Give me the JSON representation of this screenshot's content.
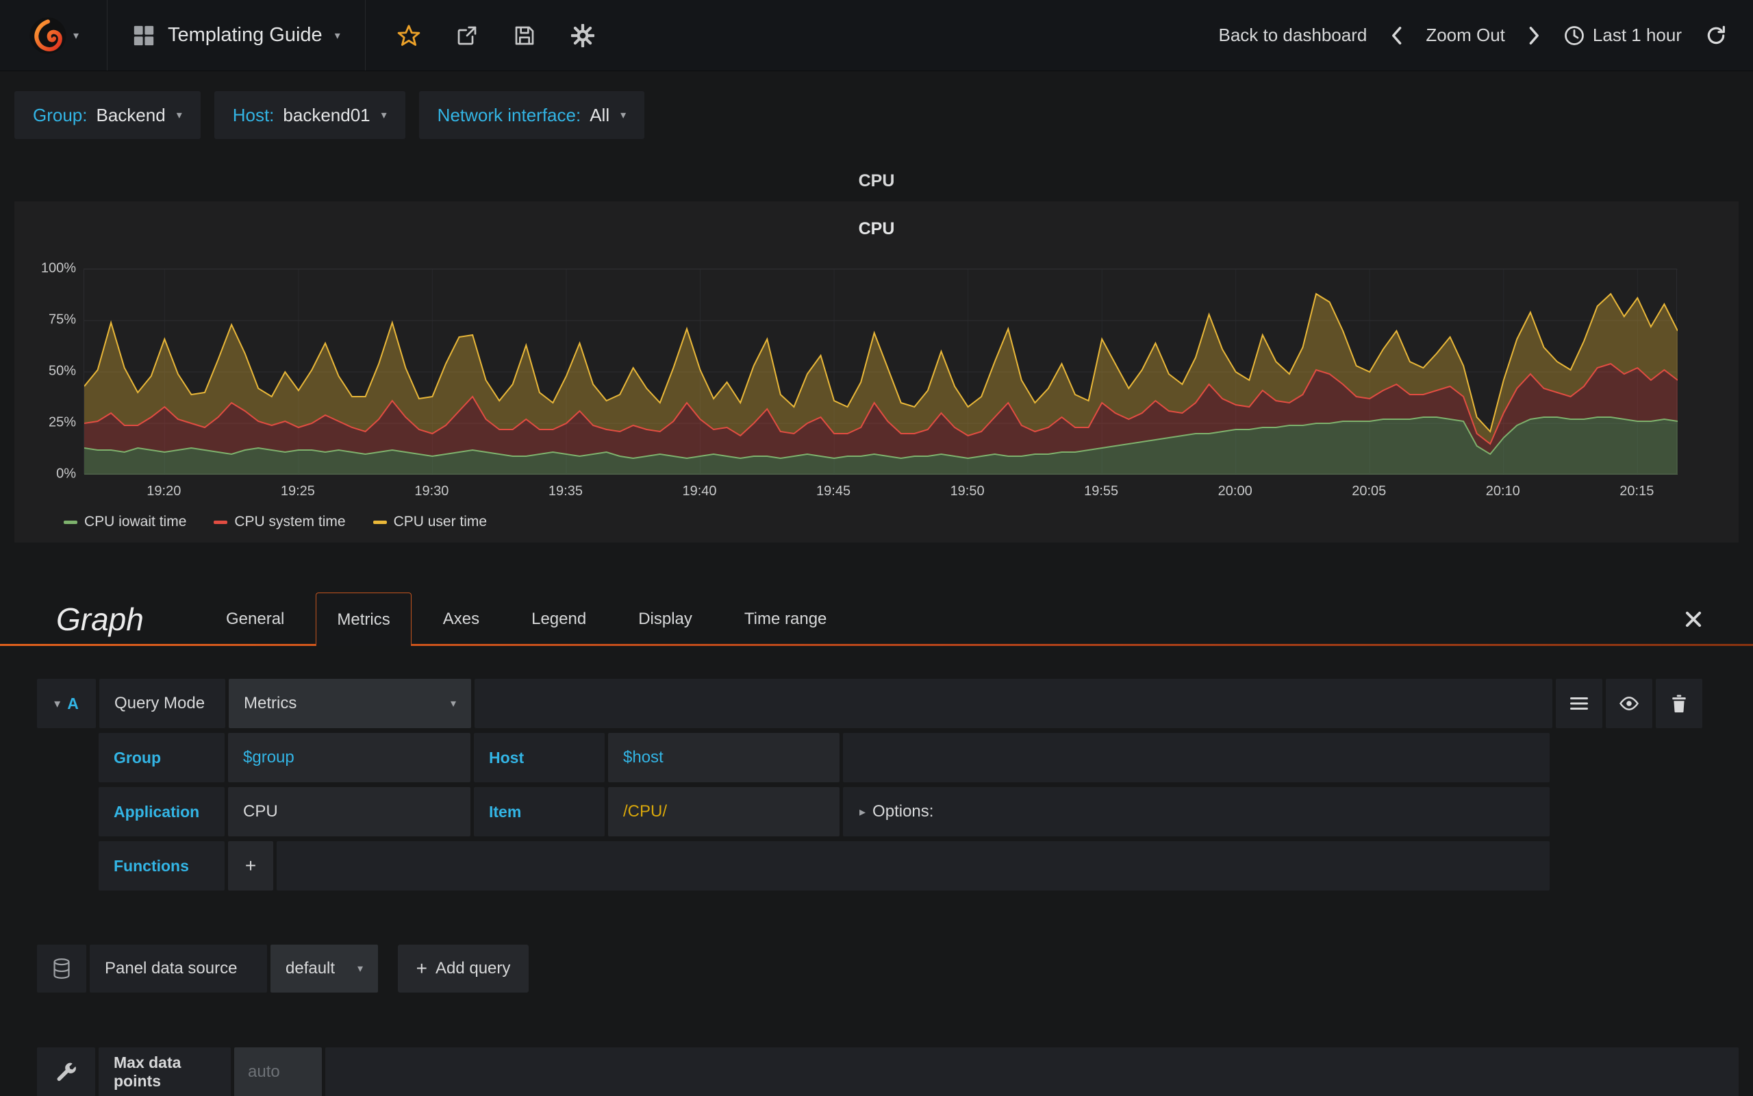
{
  "navbar": {
    "dashboard_title": "Templating Guide",
    "back_to_dashboard": "Back to dashboard",
    "zoom_out": "Zoom Out",
    "time_range": "Last 1 hour"
  },
  "template_vars": [
    {
      "label": "Group:",
      "value": "Backend"
    },
    {
      "label": "Host:",
      "value": "backend01"
    },
    {
      "label": "Network interface:",
      "value": "All"
    }
  ],
  "row_title": "CPU",
  "panel": {
    "title": "CPU"
  },
  "chart_data": {
    "type": "area",
    "stacked": true,
    "title": "CPU",
    "ylim": [
      0,
      100
    ],
    "x_min": 0,
    "x_max": 59.5,
    "point_interval_min": 0.5,
    "x_ticks": [
      {
        "m": 3,
        "label": "19:20"
      },
      {
        "m": 8,
        "label": "19:25"
      },
      {
        "m": 13,
        "label": "19:30"
      },
      {
        "m": 18,
        "label": "19:35"
      },
      {
        "m": 23,
        "label": "19:40"
      },
      {
        "m": 28,
        "label": "19:45"
      },
      {
        "m": 33,
        "label": "19:50"
      },
      {
        "m": 38,
        "label": "19:55"
      },
      {
        "m": 43,
        "label": "20:00"
      },
      {
        "m": 48,
        "label": "20:05"
      },
      {
        "m": 53,
        "label": "20:10"
      },
      {
        "m": 58,
        "label": "20:15"
      }
    ],
    "y_ticks": [
      {
        "v": 0,
        "label": "0%"
      },
      {
        "v": 25,
        "label": "25%"
      },
      {
        "v": 50,
        "label": "50%"
      },
      {
        "v": 75,
        "label": "75%"
      },
      {
        "v": 100,
        "label": "100%"
      }
    ],
    "series": [
      {
        "name": "CPU iowait time",
        "color": "#7eb26d",
        "fill": "rgba(126,178,109,0.35)",
        "values": [
          13,
          12,
          12,
          11,
          13,
          12,
          11,
          12,
          13,
          12,
          11,
          10,
          12,
          13,
          12,
          11,
          12,
          12,
          11,
          12,
          11,
          10,
          11,
          12,
          11,
          10,
          9,
          10,
          11,
          12,
          11,
          10,
          9,
          9,
          10,
          11,
          10,
          9,
          10,
          11,
          9,
          8,
          9,
          10,
          9,
          8,
          9,
          10,
          9,
          8,
          9,
          9,
          8,
          9,
          10,
          9,
          8,
          9,
          9,
          10,
          9,
          8,
          9,
          9,
          10,
          9,
          8,
          9,
          10,
          9,
          9,
          10,
          10,
          11,
          11,
          12,
          13,
          14,
          15,
          16,
          17,
          18,
          19,
          20,
          20,
          21,
          22,
          22,
          23,
          23,
          24,
          24,
          25,
          25,
          26,
          26,
          26,
          27,
          27,
          27,
          28,
          28,
          27,
          26,
          14,
          10,
          18,
          24,
          27,
          28,
          28,
          27,
          27,
          28,
          28,
          27,
          26,
          26,
          27,
          26
        ]
      },
      {
        "name": "CPU system time",
        "color": "#e24d42",
        "fill": "rgba(226,77,66,0.30)",
        "values": [
          12,
          14,
          18,
          13,
          11,
          16,
          22,
          15,
          12,
          11,
          17,
          25,
          19,
          13,
          12,
          15,
          11,
          13,
          18,
          14,
          12,
          11,
          16,
          24,
          17,
          12,
          11,
          14,
          20,
          26,
          16,
          12,
          13,
          18,
          12,
          11,
          15,
          22,
          14,
          11,
          12,
          16,
          13,
          11,
          17,
          27,
          18,
          12,
          14,
          11,
          16,
          23,
          13,
          11,
          15,
          19,
          12,
          11,
          14,
          25,
          17,
          12,
          11,
          13,
          20,
          14,
          11,
          12,
          18,
          26,
          15,
          11,
          13,
          17,
          12,
          11,
          22,
          16,
          12,
          14,
          19,
          13,
          11,
          15,
          24,
          16,
          12,
          11,
          18,
          13,
          11,
          15,
          26,
          24,
          18,
          12,
          11,
          14,
          17,
          12,
          11,
          13,
          16,
          12,
          6,
          5,
          12,
          18,
          22,
          14,
          12,
          11,
          16,
          24,
          26,
          22,
          26,
          20,
          24,
          20
        ]
      },
      {
        "name": "CPU user time",
        "color": "#eab839",
        "fill": "rgba(234,184,57,0.32)",
        "values": [
          18,
          25,
          44,
          28,
          16,
          20,
          33,
          22,
          14,
          17,
          28,
          38,
          28,
          16,
          14,
          24,
          18,
          26,
          35,
          22,
          15,
          17,
          27,
          38,
          24,
          15,
          18,
          30,
          36,
          30,
          19,
          14,
          22,
          36,
          18,
          13,
          23,
          33,
          20,
          14,
          18,
          28,
          20,
          14,
          26,
          36,
          24,
          15,
          22,
          16,
          28,
          34,
          18,
          13,
          24,
          30,
          16,
          13,
          22,
          34,
          26,
          15,
          13,
          19,
          30,
          20,
          14,
          17,
          27,
          36,
          22,
          14,
          19,
          26,
          16,
          13,
          31,
          24,
          15,
          21,
          28,
          18,
          14,
          22,
          34,
          24,
          16,
          13,
          27,
          19,
          14,
          23,
          37,
          35,
          26,
          15,
          13,
          20,
          26,
          16,
          13,
          18,
          24,
          15,
          8,
          6,
          16,
          24,
          30,
          20,
          15,
          13,
          22,
          30,
          34,
          28,
          34,
          26,
          32,
          24
        ]
      }
    ]
  },
  "editor": {
    "panel_type": "Graph",
    "tabs": [
      {
        "label": "General"
      },
      {
        "label": "Metrics",
        "active": true
      },
      {
        "label": "Axes"
      },
      {
        "label": "Legend"
      },
      {
        "label": "Display"
      },
      {
        "label": "Time range"
      }
    ],
    "query": {
      "ref_id": "A",
      "query_mode_label": "Query Mode",
      "query_mode_value": "Metrics",
      "group_label": "Group",
      "group_value": "$group",
      "host_label": "Host",
      "host_value": "$host",
      "application_label": "Application",
      "application_value": "CPU",
      "item_label": "Item",
      "item_value": "/CPU/",
      "options_label": "Options:",
      "functions_label": "Functions",
      "add_function_label": "+"
    },
    "datasource": {
      "label": "Panel data source",
      "value": "default",
      "add_icon": "+",
      "add_query_label": "Add query"
    },
    "max_data_points": {
      "label": "Max data points",
      "placeholder": "auto"
    }
  }
}
